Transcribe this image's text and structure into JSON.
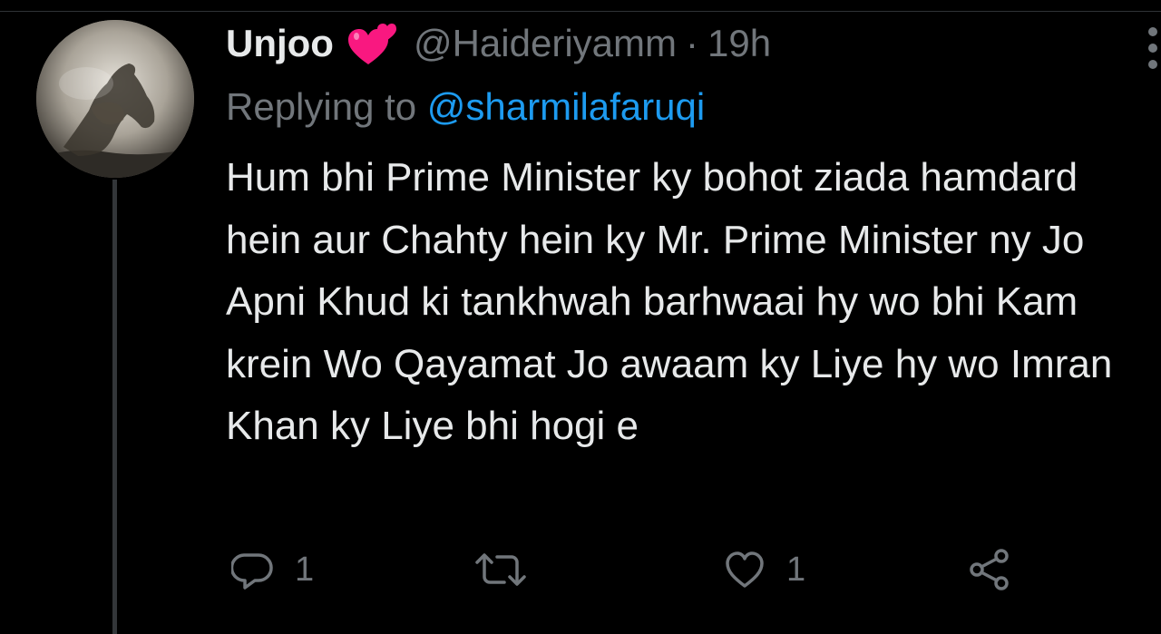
{
  "tweet": {
    "display_name": "Unjoo",
    "name_emoji": "two-hearts-icon",
    "handle": "@Haideriyamm",
    "separator": "·",
    "time": "19h",
    "replying_prefix": "Replying to",
    "replying_to": "@sharmilafaruqi",
    "text": "Hum bhi Prime Minister ky bohot ziada hamdard hein aur Chahty hein ky Mr. Prime Minister ny Jo Apni Khud ki tankhwah barhwaai hy wo bhi Kam krein Wo Qayamat Jo awaam ky Liye hy wo Imran Khan ky Liye bhi hogi e"
  },
  "actions": {
    "reply_count": "1",
    "retweet_count": "",
    "like_count": "1"
  },
  "colors": {
    "background": "#000000",
    "text_primary": "#e7e9ea",
    "text_secondary": "#71767b",
    "accent": "#1d9bf0",
    "heart": "#f91880"
  }
}
